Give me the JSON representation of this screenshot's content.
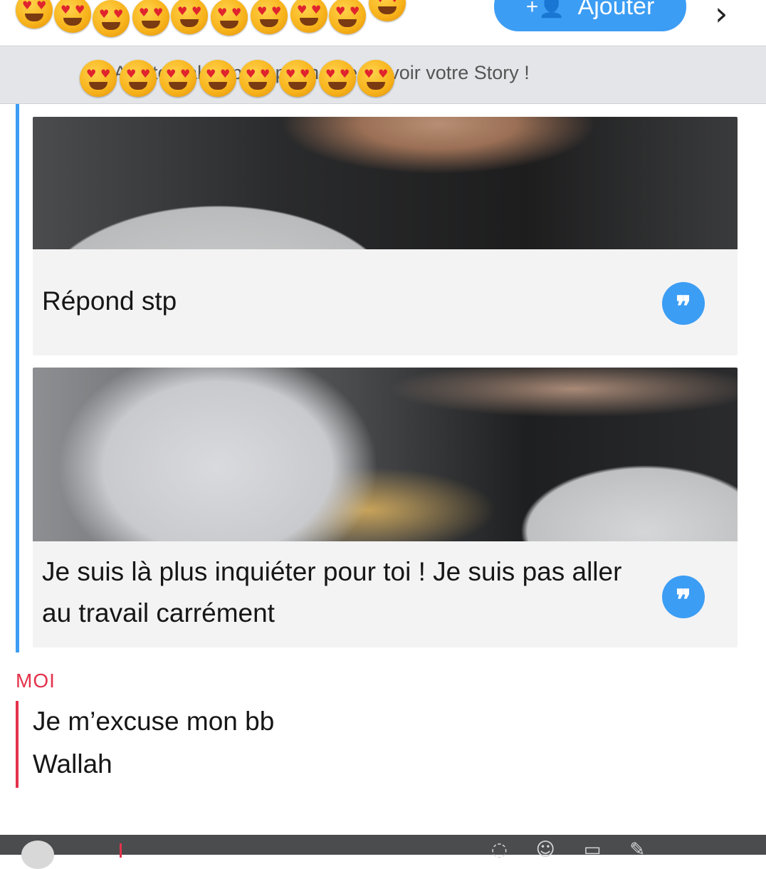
{
  "header": {
    "add_label": "Ajouter",
    "add_icon": "add-friend-icon",
    "chevron_icon": "chevron-right-icon",
    "emoji_count": 10
  },
  "banner": {
    "text": "Ajoute Pak… pour permettre de voir votre Story !"
  },
  "messages": [
    {
      "caption": "Répond stp",
      "icon": "quote-icon"
    },
    {
      "caption": "Je suis là plus inquiéter pour toi ! Je suis pas aller au travail carrément",
      "icon": "quote-icon"
    }
  ],
  "me": {
    "label": "MOI",
    "lines": [
      "Je m’excuse mon bb",
      "Wallah"
    ]
  },
  "colors": {
    "accent_blue": "#3c9df4",
    "me_red": "#e4324b",
    "banner_bg": "#e3e5e8"
  }
}
